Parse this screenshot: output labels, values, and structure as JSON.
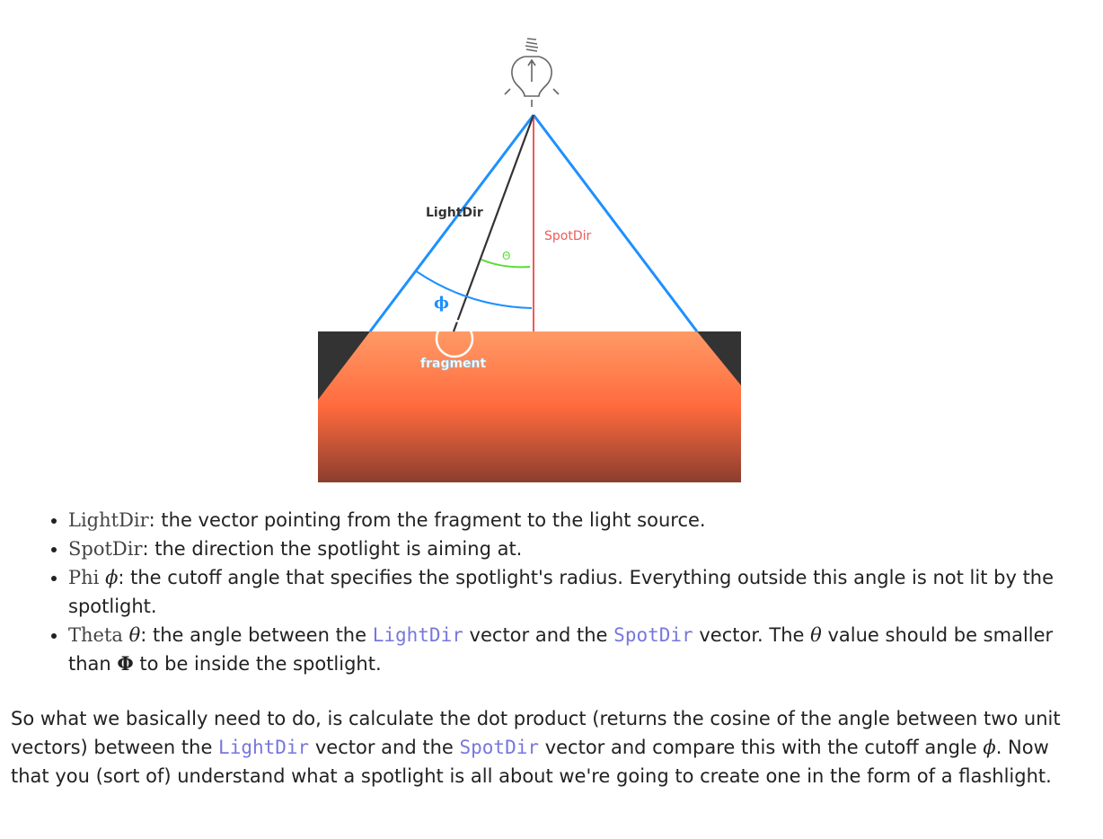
{
  "diagram": {
    "labels": {
      "light_dir": "LightDir",
      "spot_dir": "SpotDir",
      "theta_symbol": "Θ",
      "phi_symbol": "ϕ",
      "fragment": "fragment"
    },
    "colors": {
      "cone": "#1e90ff",
      "spot_dir": "#f05a5a",
      "light_dir": "#333333",
      "theta_arc": "#55dd33",
      "surface_top": "#ff9a66",
      "surface_mid": "#ff6a3d",
      "surface_bottom": "#8b3e2f",
      "unlit_corner": "#333333"
    }
  },
  "bullets": [
    {
      "term": "LightDir",
      "text": ": the vector pointing from the fragment to the light source."
    },
    {
      "term": "SpotDir",
      "text": ": the direction the spotlight is aiming at."
    },
    {
      "term": "Phi",
      "symbol": "ϕ",
      "text": ": the cutoff angle that specifies the spotlight's radius. Everything outside this angle is not lit by the spotlight."
    },
    {
      "term": "Theta",
      "symbol": "θ",
      "text_1": ": the angle between the ",
      "code_1": "LightDir",
      "text_2": " vector and the ",
      "code_2": "SpotDir",
      "text_3": " vector. The ",
      "symbol_2": "θ",
      "text_4": " value should be smaller than ",
      "symbol_3": "Φ",
      "text_5": " to be inside the spotlight."
    }
  ],
  "paragraph": {
    "text_1": "So what we basically need to do, is calculate the dot product (returns the cosine of the angle between two unit vectors) between the ",
    "code_1": "LightDir",
    "text_2": " vector and the ",
    "code_2": "SpotDir",
    "text_3": " vector and compare this with the cutoff angle ",
    "symbol": "ϕ",
    "text_4": ". Now that you (sort of) understand what a spotlight is all about we're going to create one in the form of a flashlight."
  }
}
